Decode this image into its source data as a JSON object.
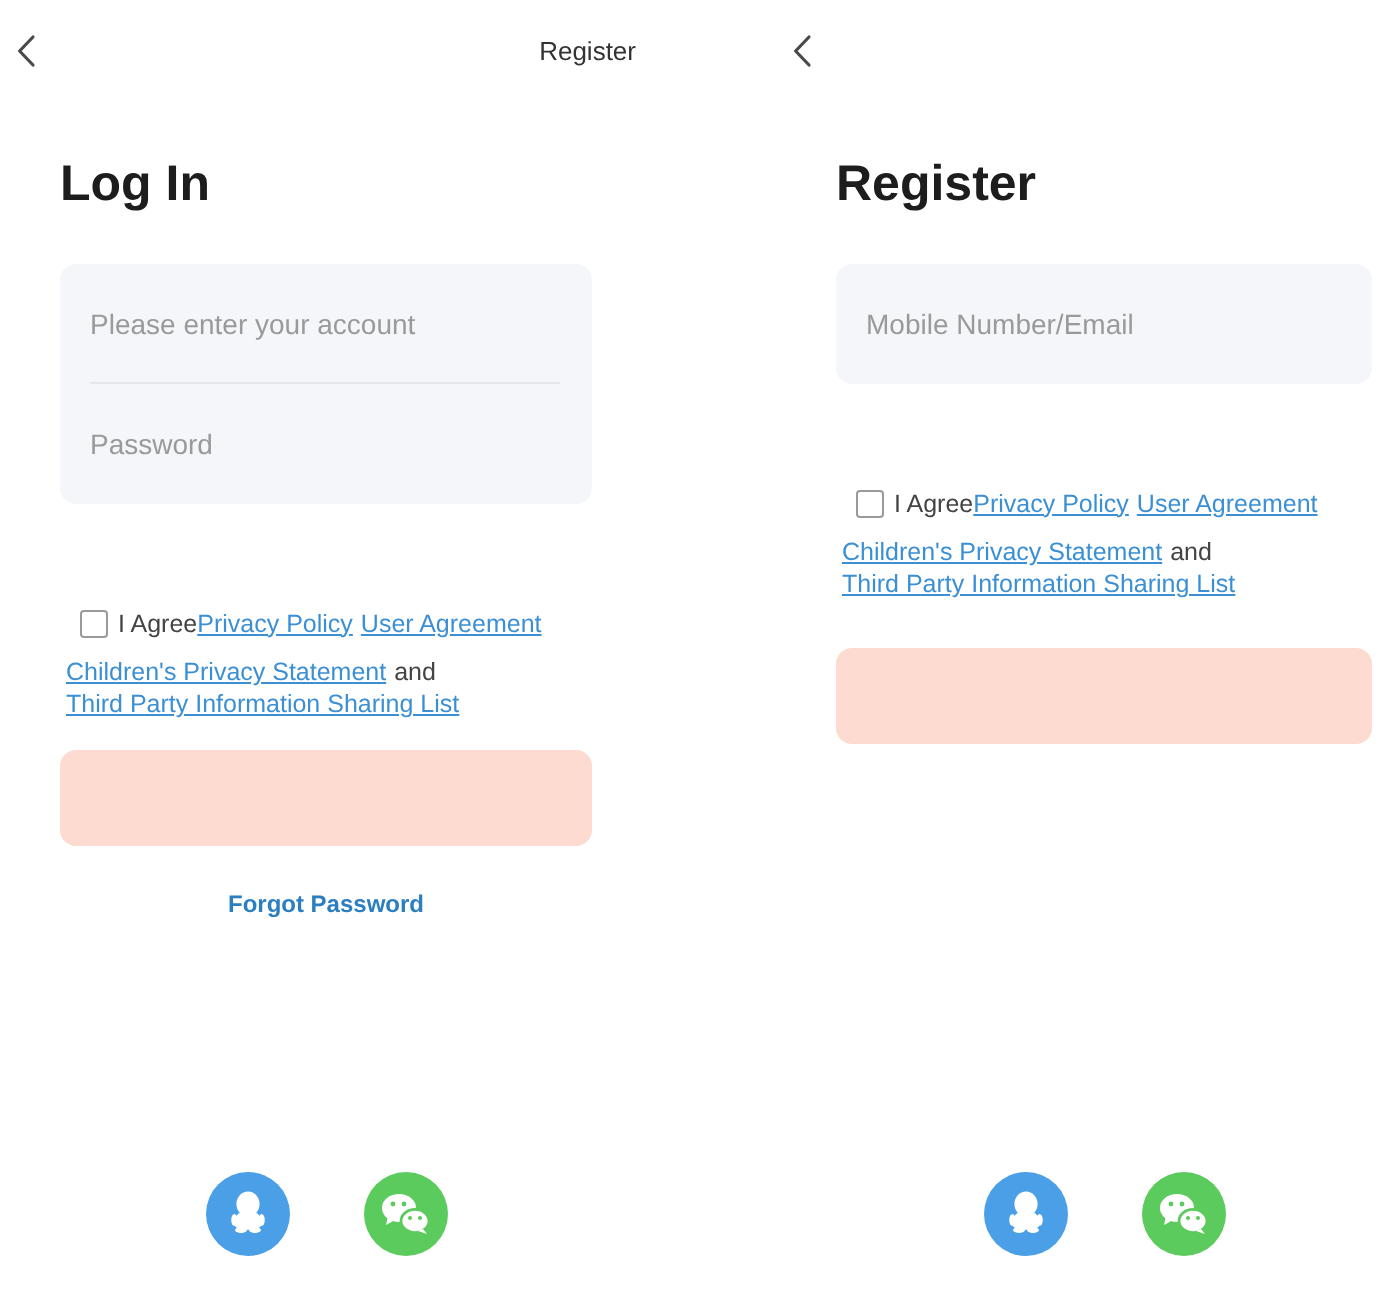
{
  "screens": [
    {
      "kind": "login",
      "header_link": "Register",
      "title": "Log In",
      "fields": [
        {
          "placeholder": "Please enter your account"
        },
        {
          "placeholder": "Password"
        }
      ],
      "agreement": {
        "checked": false,
        "lines": [
          [
            {
              "kind": "text",
              "text": "I Agree"
            },
            {
              "kind": "link",
              "text": "Privacy Policy"
            },
            {
              "kind": "link",
              "text": "User Agreement"
            }
          ],
          [
            {
              "kind": "link",
              "text": "Children's Privacy Statement"
            },
            {
              "kind": "text",
              "text": "and"
            }
          ],
          [
            {
              "kind": "link",
              "text": "Third Party Information Sharing List"
            }
          ]
        ]
      },
      "submit_button": {
        "disabled": true
      },
      "forgot_link": "Forgot Password"
    },
    {
      "kind": "register",
      "title": "Register",
      "fields": [
        {
          "placeholder": "Mobile Number/Email"
        }
      ],
      "agreement": {
        "checked": false,
        "lines": [
          [
            {
              "kind": "text",
              "text": "I Agree"
            },
            {
              "kind": "link",
              "text": "Privacy Policy"
            },
            {
              "kind": "link",
              "text": "User Agreement"
            }
          ],
          [
            {
              "kind": "link",
              "text": "Children's Privacy Statement"
            },
            {
              "kind": "text",
              "text": "and"
            }
          ],
          [
            {
              "kind": "link",
              "text": "Third Party Information Sharing List"
            }
          ]
        ]
      },
      "submit_button": {
        "disabled": true
      }
    }
  ]
}
